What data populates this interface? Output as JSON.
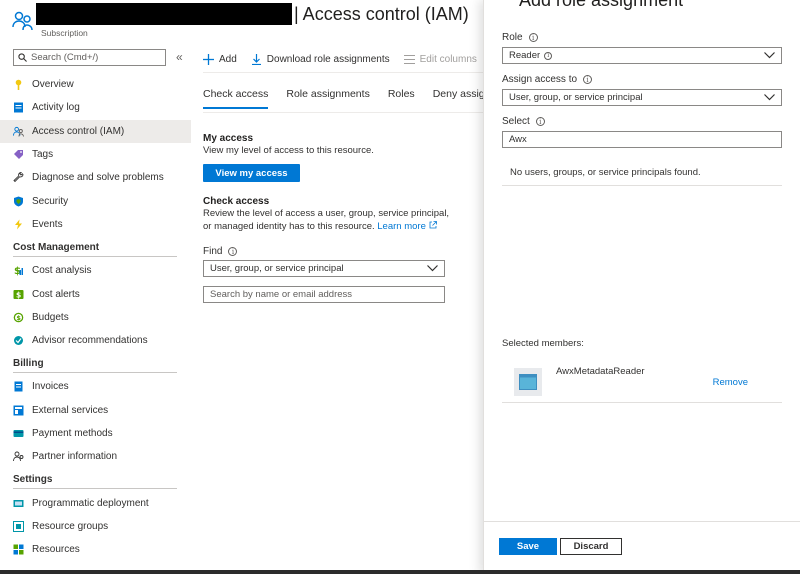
{
  "header": {
    "title": "| Access control (IAM)",
    "subtitle": "Subscription"
  },
  "sidebar": {
    "search_placeholder": "Search (Cmd+/)",
    "collapse_glyph": "«",
    "items": [
      {
        "label": "Overview",
        "icon": "key-icon",
        "color": "#f2c811"
      },
      {
        "label": "Activity log",
        "icon": "activity-log-icon",
        "color": "#0078d4"
      },
      {
        "label": "Access control (IAM)",
        "icon": "people-icon",
        "color": "#0078d4",
        "active": true
      },
      {
        "label": "Tags",
        "icon": "tag-icon",
        "color": "#8661c5"
      },
      {
        "label": "Diagnose and solve problems",
        "icon": "wrench-icon",
        "color": "#605e5c"
      },
      {
        "label": "Security",
        "icon": "shield-icon",
        "color": "#0078d4"
      },
      {
        "label": "Events",
        "icon": "lightning-icon",
        "color": "#f2c811"
      }
    ],
    "groups": [
      {
        "title": "Cost Management",
        "items": [
          {
            "label": "Cost analysis",
            "icon": "cost-analysis-icon",
            "color": "#57a300"
          },
          {
            "label": "Cost alerts",
            "icon": "cost-alerts-icon",
            "color": "#57a300"
          },
          {
            "label": "Budgets",
            "icon": "budgets-icon",
            "color": "#57a300"
          },
          {
            "label": "Advisor recommendations",
            "icon": "advisor-icon",
            "color": "#0096a8"
          }
        ]
      },
      {
        "title": "Billing",
        "items": [
          {
            "label": "Invoices",
            "icon": "invoice-icon",
            "color": "#0078d4"
          },
          {
            "label": "External services",
            "icon": "external-services-icon",
            "color": "#0078d4"
          },
          {
            "label": "Payment methods",
            "icon": "payment-icon",
            "color": "#0096a8"
          },
          {
            "label": "Partner information",
            "icon": "partner-icon",
            "color": "#605e5c"
          }
        ]
      },
      {
        "title": "Settings",
        "items": [
          {
            "label": "Programmatic deployment",
            "icon": "deployment-icon",
            "color": "#0096a8"
          },
          {
            "label": "Resource groups",
            "icon": "resource-groups-icon",
            "color": "#0096a8"
          },
          {
            "label": "Resources",
            "icon": "resources-icon",
            "color": "#57a300"
          }
        ]
      }
    ]
  },
  "toolbar": {
    "add": "Add",
    "download": "Download role assignments",
    "edit_columns": "Edit columns"
  },
  "tabs": [
    "Check access",
    "Role assignments",
    "Roles",
    "Deny assignm"
  ],
  "main": {
    "my_access_title": "My access",
    "my_access_text": "View my level of access to this resource.",
    "view_my_access": "View my access",
    "check_access_title": "Check access",
    "check_access_text1": "Review the level of access a user, group, service principal,",
    "check_access_text2": "or managed identity has to this resource.",
    "learn_more": "Learn more",
    "find_label": "Find",
    "find_value": "User, group, or service principal",
    "search_placeholder": "Search by name or email address"
  },
  "panel": {
    "title": "Add role assignment",
    "role_label": "Role",
    "role_value": "Reader",
    "assign_label": "Assign access to",
    "assign_value": "User, group, or service principal",
    "select_label": "Select",
    "select_value": "Awx",
    "no_results": "No users, groups, or service principals found.",
    "members_label": "Selected members:",
    "member_name": "AwxMetadataReader",
    "remove": "Remove",
    "save": "Save",
    "discard": "Discard"
  }
}
